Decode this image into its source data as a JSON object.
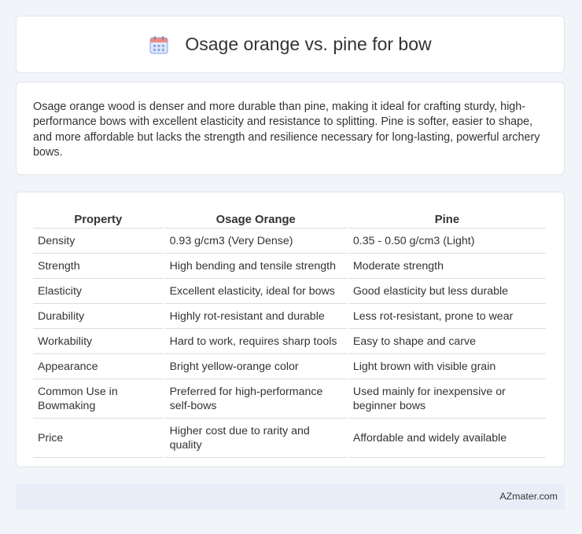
{
  "header": {
    "title": "Osage orange vs. pine for bow",
    "icon": "calendar-icon"
  },
  "summary": "Osage orange wood is denser and more durable than pine, making it ideal for crafting sturdy, high-performance bows with excellent elasticity and resistance to splitting. Pine is softer, easier to shape, and more affordable but lacks the strength and resilience necessary for long-lasting, powerful archery bows.",
  "table": {
    "headers": [
      "Property",
      "Osage Orange",
      "Pine"
    ],
    "rows": [
      [
        "Density",
        "0.93 g/cm3 (Very Dense)",
        "0.35 - 0.50 g/cm3 (Light)"
      ],
      [
        "Strength",
        "High bending and tensile strength",
        "Moderate strength"
      ],
      [
        "Elasticity",
        "Excellent elasticity, ideal for bows",
        "Good elasticity but less durable"
      ],
      [
        "Durability",
        "Highly rot-resistant and durable",
        "Less rot-resistant, prone to wear"
      ],
      [
        "Workability",
        "Hard to work, requires sharp tools",
        "Easy to shape and carve"
      ],
      [
        "Appearance",
        "Bright yellow-orange color",
        "Light brown with visible grain"
      ],
      [
        "Common Use in Bowmaking",
        "Preferred for high-performance self-bows",
        "Used mainly for inexpensive or beginner bows"
      ],
      [
        "Price",
        "Higher cost due to rarity and quality",
        "Affordable and widely available"
      ]
    ]
  },
  "footer": {
    "link": "AZmater.com"
  },
  "colors": {
    "background": "#f1f4f8",
    "card": "#ffffff",
    "footer": "#e8eef7",
    "icon_blue": "#5b8def",
    "icon_red": "#f06a6a"
  }
}
